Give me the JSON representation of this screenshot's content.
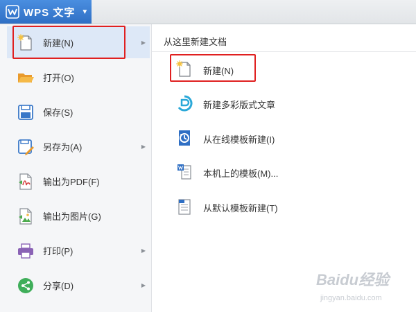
{
  "app": {
    "title": "WPS 文字"
  },
  "left_menu": [
    {
      "label": "新建(N)",
      "icon": "new-doc-icon"
    },
    {
      "label": "打开(O)",
      "icon": "folder-open-icon"
    },
    {
      "label": "保存(S)",
      "icon": "save-icon"
    },
    {
      "label": "另存为(A)",
      "icon": "save-as-icon"
    },
    {
      "label": "输出为PDF(F)",
      "icon": "export-pdf-icon"
    },
    {
      "label": "输出为图片(G)",
      "icon": "export-image-icon"
    },
    {
      "label": "打印(P)",
      "icon": "print-icon"
    },
    {
      "label": "分享(D)",
      "icon": "share-icon"
    }
  ],
  "submenu": {
    "header": "从这里新建文档",
    "items": [
      {
        "label": "新建(N)",
        "icon": "new-doc-icon"
      },
      {
        "label": "新建多彩版式文章",
        "icon": "colorful-article-icon"
      },
      {
        "label": "从在线模板新建(I)",
        "icon": "online-template-icon"
      },
      {
        "label": "本机上的模板(M)...",
        "icon": "local-template-icon"
      },
      {
        "label": "从默认模板新建(T)",
        "icon": "default-template-icon"
      }
    ]
  },
  "watermark": {
    "main": "Baidu经验",
    "sub": "jingyan.baidu.com"
  },
  "colors": {
    "accent": "#2f6fc4",
    "highlight": "#e02020",
    "selected_bg": "#dde8f7"
  }
}
